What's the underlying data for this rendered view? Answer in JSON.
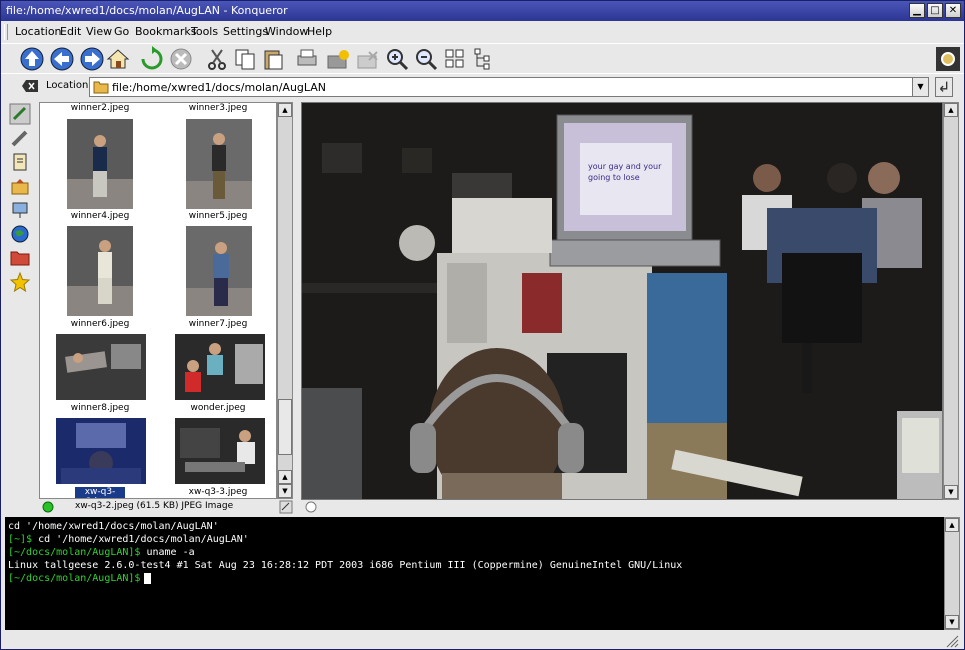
{
  "window": {
    "title": "file:/home/xwred1/docs/molan/AugLAN - Konqueror"
  },
  "menu": [
    "Location",
    "Edit",
    "View",
    "Go",
    "Bookmarks",
    "Tools",
    "Settings",
    "Window",
    "Help"
  ],
  "location": {
    "label": "Location:",
    "value": "file:/home/xwred1/docs/molan/AugLAN"
  },
  "thumbnails": [
    {
      "caption": "winner2.jpeg"
    },
    {
      "caption": "winner3.jpeg"
    },
    {
      "caption": "winner4.jpeg"
    },
    {
      "caption": "winner5.jpeg"
    },
    {
      "caption": "winner6.jpeg"
    },
    {
      "caption": "winner7.jpeg"
    },
    {
      "caption": "winner8.jpeg"
    },
    {
      "caption": "wonder.jpeg"
    },
    {
      "caption": "xw-q3-2.jpeg"
    },
    {
      "caption": "xw-q3-3.jpeg"
    }
  ],
  "status": {
    "text": "xw-q3-2.jpeg (61.5 KB)  JPEG Image"
  },
  "photo": {
    "laptop_text_1": "your gay and your",
    "laptop_text_2": "going to lose"
  },
  "terminal": {
    "line1": "cd '/home/xwred1/docs/molan/AugLAN'",
    "line2_prompt": "[~]$",
    "line2_cmd": " cd '/home/xwred1/docs/molan/AugLAN'",
    "line3_prompt": "[~/docs/molan/AugLAN]$",
    "line3_cmd": " uname -a",
    "line4": "Linux tallgeese 2.6.0-test4 #1 Sat Aug 23 16:28:12 PDT 2003 i686 Pentium III (Coppermine) GenuineIntel GNU/Linux",
    "line5_prompt": "[~/docs/molan/AugLAN]$"
  }
}
